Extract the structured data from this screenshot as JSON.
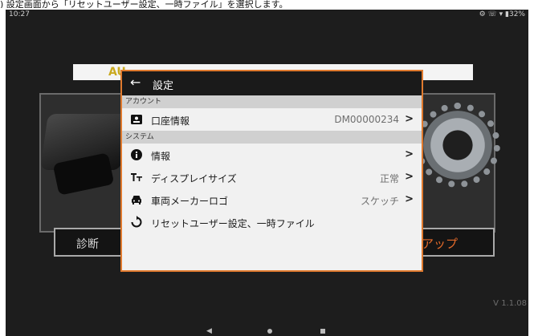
{
  "caption": ") 設定画面から「リセットユーザー設定、一時ファイル」を選択します。",
  "status_bar": {
    "time": "10:27",
    "indicators": "⚙ ☏ ▾ ▮32%"
  },
  "background_app": {
    "banner_text": "AU",
    "left_button_label": "診断",
    "right_button_label": "セットアップ",
    "version": "V 1.1.08",
    "accent_color": "#e36a2a"
  },
  "dialog": {
    "back_icon": "back-arrow-icon",
    "title": "設定",
    "sections": [
      {
        "label": "アカウント"
      },
      {
        "label": "システム"
      }
    ],
    "rows": [
      {
        "icon": "account-card-icon",
        "label": "口座情報",
        "value": "DM00000234",
        "chevron": ">"
      },
      {
        "icon": "info-icon",
        "label": "情報",
        "value": "",
        "chevron": ">"
      },
      {
        "icon": "text-size-icon",
        "label": "ディスプレイサイズ",
        "value": "正常",
        "chevron": ">"
      },
      {
        "icon": "car-icon",
        "label": "車両メーカーロゴ",
        "value": "スケッチ",
        "chevron": ">"
      },
      {
        "icon": "reset-icon",
        "label": "リセットユーザー設定、一時ファイル",
        "value": "",
        "chevron": ""
      }
    ],
    "border_color": "#e07a2e"
  },
  "nav_bar": {
    "back": "◀"
  }
}
